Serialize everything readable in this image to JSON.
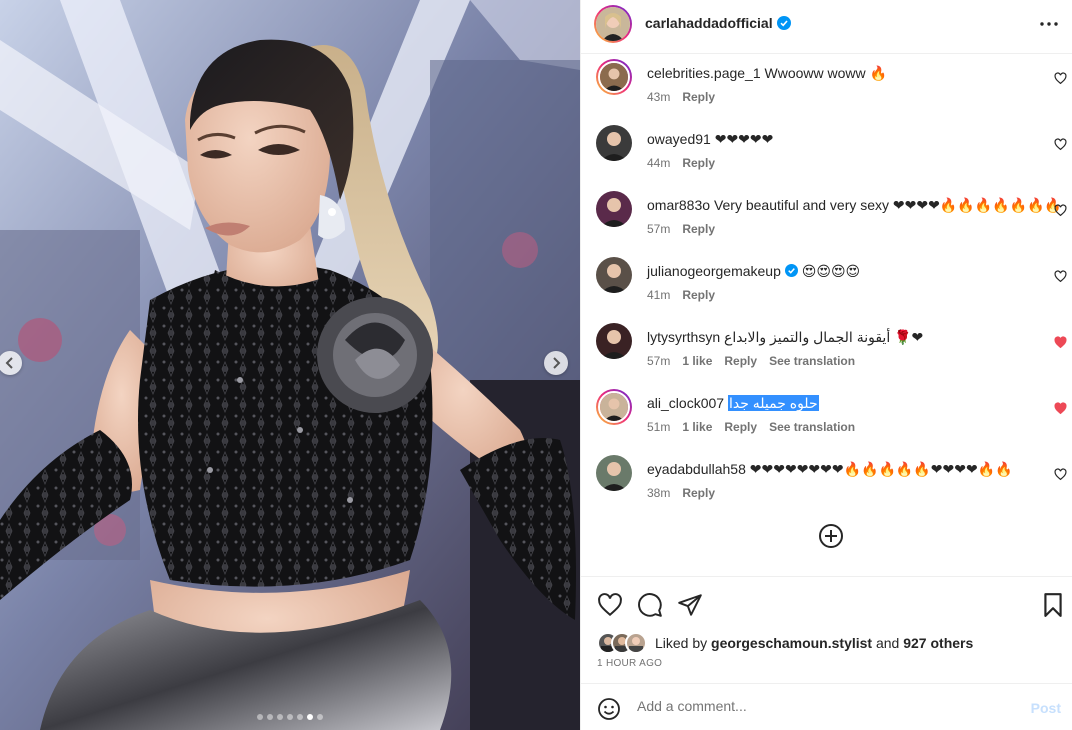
{
  "post": {
    "username": "carlahaddadofficial",
    "verified": true,
    "more_icon": "more-horizontal-icon"
  },
  "comments": [
    {
      "user": "celebrities.page_1",
      "text": "Wwooww woww 🔥",
      "time": "43m",
      "likes": "",
      "reply": "Reply",
      "translate": "",
      "liked": false,
      "verified": false,
      "ring": true
    },
    {
      "user": "owayed91",
      "text": "❤❤❤❤❤",
      "time": "44m",
      "likes": "",
      "reply": "Reply",
      "translate": "",
      "liked": false,
      "verified": false,
      "ring": false
    },
    {
      "user": "omar883o",
      "text": "Very beautiful and very sexy ❤❤❤❤🔥🔥🔥🔥🔥🔥🔥",
      "time": "57m",
      "likes": "",
      "reply": "Reply",
      "translate": "",
      "liked": false,
      "verified": false,
      "ring": false
    },
    {
      "user": "julianogeorgemakeup",
      "text": "😍😍😍😍",
      "time": "41m",
      "likes": "",
      "reply": "Reply",
      "translate": "",
      "liked": false,
      "verified": true,
      "ring": false
    },
    {
      "user": "lytysyrthsyn",
      "text": "أيقونة الجمال والتميز والابداع 🌹❤",
      "time": "57m",
      "likes": "1 like",
      "reply": "Reply",
      "translate": "See translation",
      "liked": true,
      "verified": false,
      "ring": false
    },
    {
      "user": "ali_clock007",
      "text": "حلوه جميله جدا",
      "time": "51m",
      "likes": "1 like",
      "reply": "Reply",
      "translate": "See translation",
      "liked": true,
      "verified": false,
      "ring": true,
      "highlighted": true
    },
    {
      "user": "eyadabdullah58",
      "text": "❤❤❤❤❤❤❤❤🔥🔥🔥🔥🔥❤❤❤❤🔥🔥",
      "time": "38m",
      "likes": "",
      "reply": "Reply",
      "translate": "",
      "liked": false,
      "verified": false,
      "ring": false
    }
  ],
  "likes": {
    "prefix": "Liked by ",
    "user": "georgeschamoun.stylist",
    "middle": " and ",
    "others": "927 others"
  },
  "timestamp": "1 HOUR AGO",
  "add_comment": {
    "placeholder": "Add a comment...",
    "post_label": "Post"
  },
  "carousel": {
    "count": 7,
    "active_index": 5
  },
  "colors": {
    "accent": "#0095f6",
    "like_red": "#ed4956",
    "text": "#262626",
    "muted": "#737373",
    "highlight": "#3390ff"
  }
}
